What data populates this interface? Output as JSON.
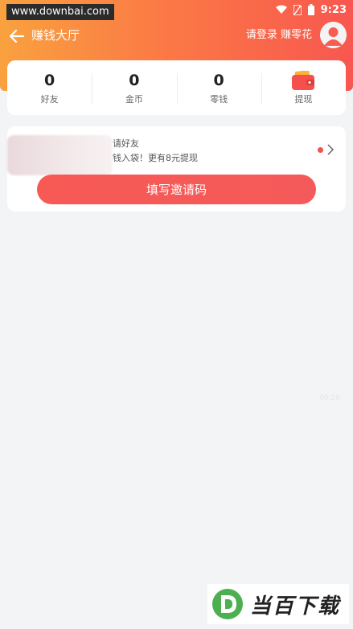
{
  "watermark": "www.downbai.com",
  "status": {
    "time": "9:23"
  },
  "header": {
    "title": "赚钱大厅",
    "login_text": "请登录 赚零花"
  },
  "stats": [
    {
      "value": "0",
      "label": "好友"
    },
    {
      "value": "0",
      "label": "金币"
    },
    {
      "value": "0",
      "label": "零钱"
    },
    {
      "label": "提现",
      "icon": "wallet-icon"
    }
  ],
  "invite": {
    "title": "请好友",
    "desc": "钱入袋！更有8元提现",
    "button_label": "填写邀请码"
  },
  "timer": "00:20",
  "logo": {
    "text": "当百下载"
  },
  "colors": {
    "accent": "#f5504b",
    "gradient_start": "#f9a13f",
    "gradient_end": "#f8574f"
  }
}
